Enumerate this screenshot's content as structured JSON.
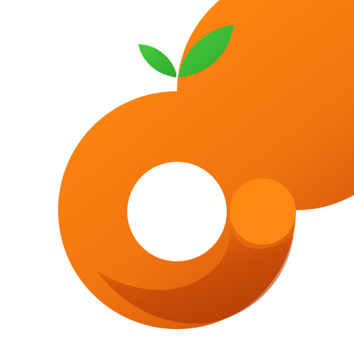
{
  "logo": {
    "name": "orange-fruit-logo",
    "icon": "orange-ring-with-leaves-icon",
    "colors": {
      "background": "#ffffff",
      "orange_light": "#ff8a10",
      "orange_mid": "#f67a12",
      "orange_dark": "#c64a0a",
      "orange_deep": "#b23d06",
      "leaf_green": "#3fc23a",
      "leaf_green_dark": "#2fae2c"
    }
  }
}
